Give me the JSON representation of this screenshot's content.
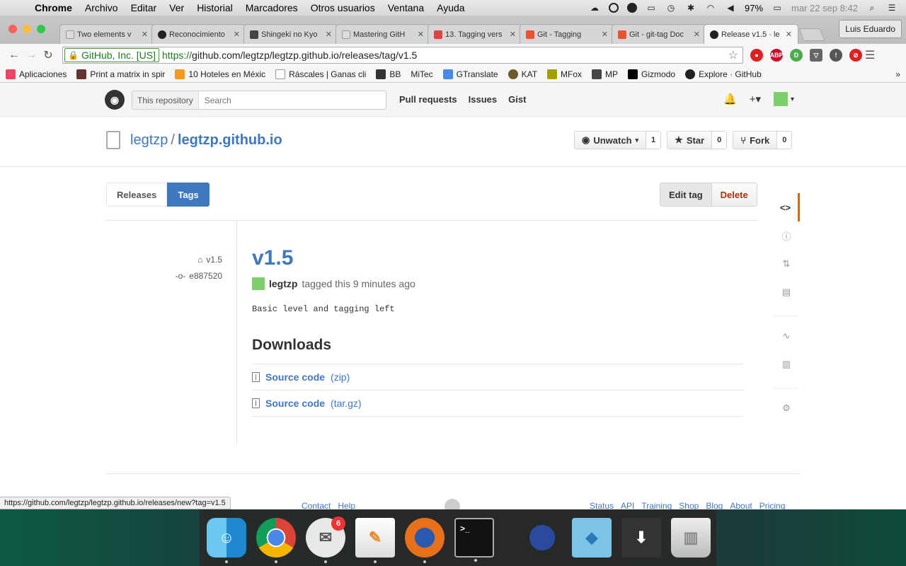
{
  "menubar": {
    "app": "Chrome",
    "items": [
      "Archivo",
      "Editar",
      "Ver",
      "Historial",
      "Marcadores",
      "Otros usuarios",
      "Ventana",
      "Ayuda"
    ],
    "battery": "97%",
    "clock": "mar 22 sep 8:42"
  },
  "tabs": [
    {
      "title": "Two elements v"
    },
    {
      "title": "Reconocimiento"
    },
    {
      "title": "Shingeki no Kyo"
    },
    {
      "title": "Mastering GitH"
    },
    {
      "title": "13. Tagging vers"
    },
    {
      "title": "Git - Tagging"
    },
    {
      "title": "Git - git-tag Doc"
    },
    {
      "title": "Release v1.5 · le"
    }
  ],
  "profile": "Luis Eduardo",
  "omnibox": {
    "ev_label": "GitHub, Inc. [US]",
    "proto": "https://",
    "url": "github.com/legtzp/legtzp.github.io/releases/tag/v1.5"
  },
  "extensions": [
    "ABP"
  ],
  "bookmarks": [
    "Aplicaciones",
    "Print a matrix in spir",
    "10 Hoteles en Méxic",
    "Ráscales | Ganas cli",
    "BB",
    "MiTec",
    "GTranslate",
    "KAT",
    "MFox",
    "MP",
    "Gizmodo",
    "Explore · GitHub"
  ],
  "gh": {
    "scope": "This repository",
    "search_placeholder": "Search",
    "nav": [
      "Pull requests",
      "Issues",
      "Gist"
    ],
    "owner": "legtzp",
    "repo": "legtzp.github.io",
    "watch": {
      "label": "Unwatch",
      "count": "1"
    },
    "star": {
      "label": "Star",
      "count": "0"
    },
    "fork": {
      "label": "Fork",
      "count": "0"
    },
    "subnav": [
      "Releases",
      "Tags"
    ],
    "edit_tag": "Edit tag",
    "delete": "Delete"
  },
  "release": {
    "tag": "v1.5",
    "commit": "e887520",
    "title": "v1.5",
    "author": "legtzp",
    "tagged_text": "tagged this 9 minutes ago",
    "body": "Basic level and tagging left",
    "downloads_heading": "Downloads",
    "downloads": [
      {
        "name": "Source code",
        "ext": "(zip)"
      },
      {
        "name": "Source code",
        "ext": "(tar.gz)"
      }
    ]
  },
  "footer": {
    "left": [
      "Contact",
      "Help"
    ],
    "right": [
      "Status",
      "API",
      "Training",
      "Shop",
      "Blog",
      "About",
      "Pricing"
    ]
  },
  "status_url": "https://github.com/legtzp/legtzp.github.io/releases/new?tag=v1.5",
  "dock": {
    "mail_badge": "6"
  }
}
